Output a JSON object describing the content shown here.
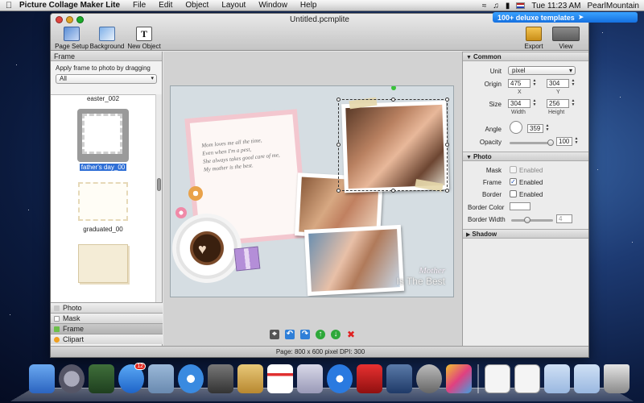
{
  "menubar": {
    "app_name": "Picture Collage Maker Lite",
    "menus": [
      "File",
      "Edit",
      "Object",
      "Layout",
      "Window",
      "Help"
    ],
    "clock": "Tue 11:23 AM",
    "user": "PearlMountain"
  },
  "window": {
    "title": "Untitled.pcmplite",
    "promo_label": "100+ deluxe templates",
    "toolbar": {
      "page_setup": "Page Setup",
      "background": "Background",
      "new_object": "New Object",
      "export": "Export",
      "view": "View"
    }
  },
  "left_panel": {
    "header": "Frame",
    "hint": "Apply frame to photo by dragging",
    "category": "All",
    "thumbnails": [
      "easter_002",
      "father's day_00",
      "graduated_00"
    ],
    "selected_thumbnail": "father's day_00",
    "sections": [
      "Photo",
      "Mask",
      "Frame",
      "Clipart"
    ]
  },
  "canvas": {
    "note_lines": [
      "Mom loves me all the time,",
      "Even when I'm a pest,",
      "She always takes good care of me,",
      "My mother is the best."
    ],
    "caption_script": "Mother",
    "caption": "Is The Best"
  },
  "status": "Page: 800 x 600 pixel DPI: 300",
  "inspector": {
    "common": {
      "title": "Common",
      "unit_label": "Unit",
      "unit_value": "pixel",
      "origin_label": "Origin",
      "origin_x": "475",
      "origin_y": "304",
      "x_label": "X",
      "y_label": "Y",
      "size_label": "Size",
      "width": "304",
      "height": "256",
      "width_label": "Width",
      "height_label": "Height",
      "angle_label": "Angle",
      "angle": "359",
      "opacity_label": "Opacity",
      "opacity": "100"
    },
    "photo": {
      "title": "Photo",
      "mask_label": "Mask",
      "mask_state": "Enabled",
      "frame_label": "Frame",
      "frame_state": "Enabled",
      "border_label": "Border",
      "border_state": "Enabled",
      "border_color_label": "Border Color",
      "border_width_label": "Border Width",
      "border_width": "4"
    },
    "shadow": {
      "title": "Shadow"
    }
  },
  "colors": {
    "accent": "#2f6fd6",
    "promo": "#1570e0",
    "selection_handle": "#3ac23a"
  }
}
